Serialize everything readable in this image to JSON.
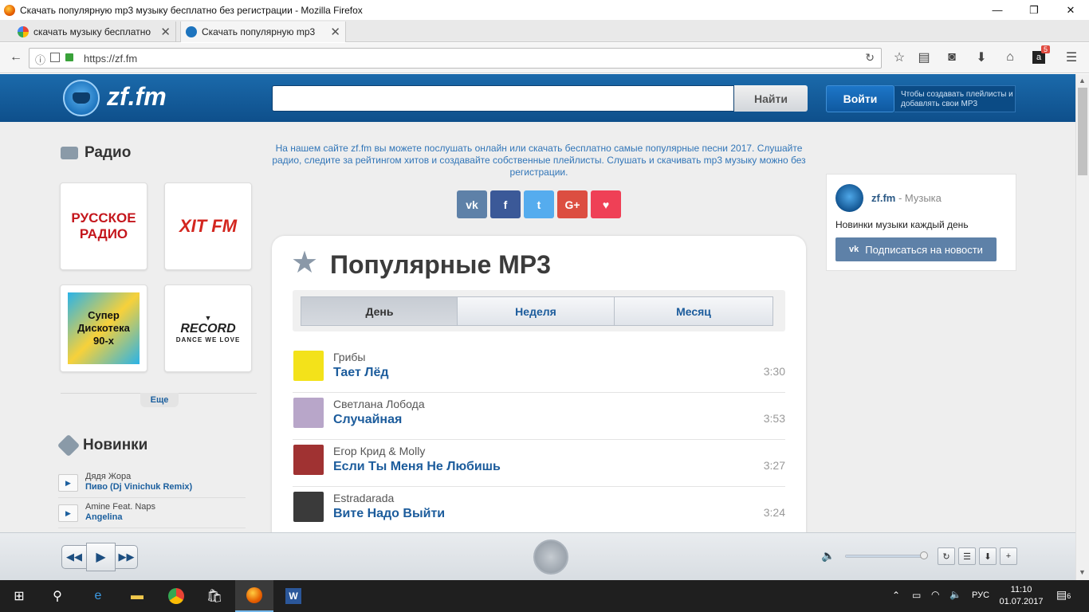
{
  "window": {
    "title": "Скачать популярную mp3 музыку бесплатно без регистрации - Mozilla Firefox"
  },
  "tabs": [
    {
      "label": "скачать музыку бесплатно"
    },
    {
      "label": "Скачать популярную mp3"
    }
  ],
  "navbar": {
    "url": "https://zf.fm",
    "notification_count": "5"
  },
  "site": {
    "logo": "zf.fm",
    "search": {
      "placeholder": "",
      "button": "Найти"
    },
    "login": {
      "button": "Войти",
      "hint": "Чтобы создавать плейлисты и добавлять свои MP3"
    }
  },
  "sidebar": {
    "radio_title": "Радио",
    "radio_stations": [
      {
        "name": "РУССКОЕ РАДИО"
      },
      {
        "name": "XIT FM"
      },
      {
        "name": "Супер Дискотека 90-х"
      },
      {
        "name": "RECORD",
        "slogan": "DANCE WE LOVE"
      }
    ],
    "more_label": "Еще",
    "new_title": "Новинки",
    "new_items": [
      {
        "artist": "Дядя Жора",
        "track": "Пиво (Dj Vinichuk Remix)"
      },
      {
        "artist": "Amine Feat. Naps",
        "track": "Angelina"
      }
    ]
  },
  "intro": "На нашем сайте zf.fm вы можете послушать онлайн или скачать бесплатно самые популярные песни 2017. Слушайте радио, следите за рейтингом хитов и создавайте собственные плейлисты. Слушать и скачивать mp3 музыку можно без регистрации.",
  "social": [
    {
      "name": "vk",
      "label": "vk",
      "color": "#5e81a8"
    },
    {
      "name": "facebook",
      "label": "f",
      "color": "#3b5998"
    },
    {
      "name": "twitter",
      "label": "t",
      "color": "#55acee"
    },
    {
      "name": "googleplus",
      "label": "G+",
      "color": "#dc4e41"
    },
    {
      "name": "pocket",
      "label": "♥",
      "color": "#ef4056"
    }
  ],
  "popular": {
    "title": "Популярные MP3",
    "periods": [
      "День",
      "Неделя",
      "Месяц"
    ],
    "active_period": "День",
    "songs": [
      {
        "artist": "Грибы",
        "title": "Тает Лёд",
        "duration": "3:30",
        "cover_color": "#f3e21a"
      },
      {
        "artist": "Светлана Лобода",
        "title": "Случайная",
        "duration": "3:53",
        "cover_color": "#b8a6c9"
      },
      {
        "artist": "Егор Крид & Molly",
        "title": "Если Ты Меня Не Любишь",
        "duration": "3:27",
        "cover_color": "#a03232"
      },
      {
        "artist": "Estradarada",
        "title": "Вите Надо Выйти",
        "duration": "3:24",
        "cover_color": "#3a3a3a"
      }
    ]
  },
  "vk_widget": {
    "name": "zf.fm",
    "name_suffix": " - Музыка",
    "description": "Новинки музыки каждый день",
    "subscribe": "Подписаться на новости"
  },
  "player": {
    "volume": 0.95
  },
  "taskbar": {
    "lang": "РУС",
    "time": "11:10",
    "date": "01.07.2017",
    "notifications": "6"
  }
}
